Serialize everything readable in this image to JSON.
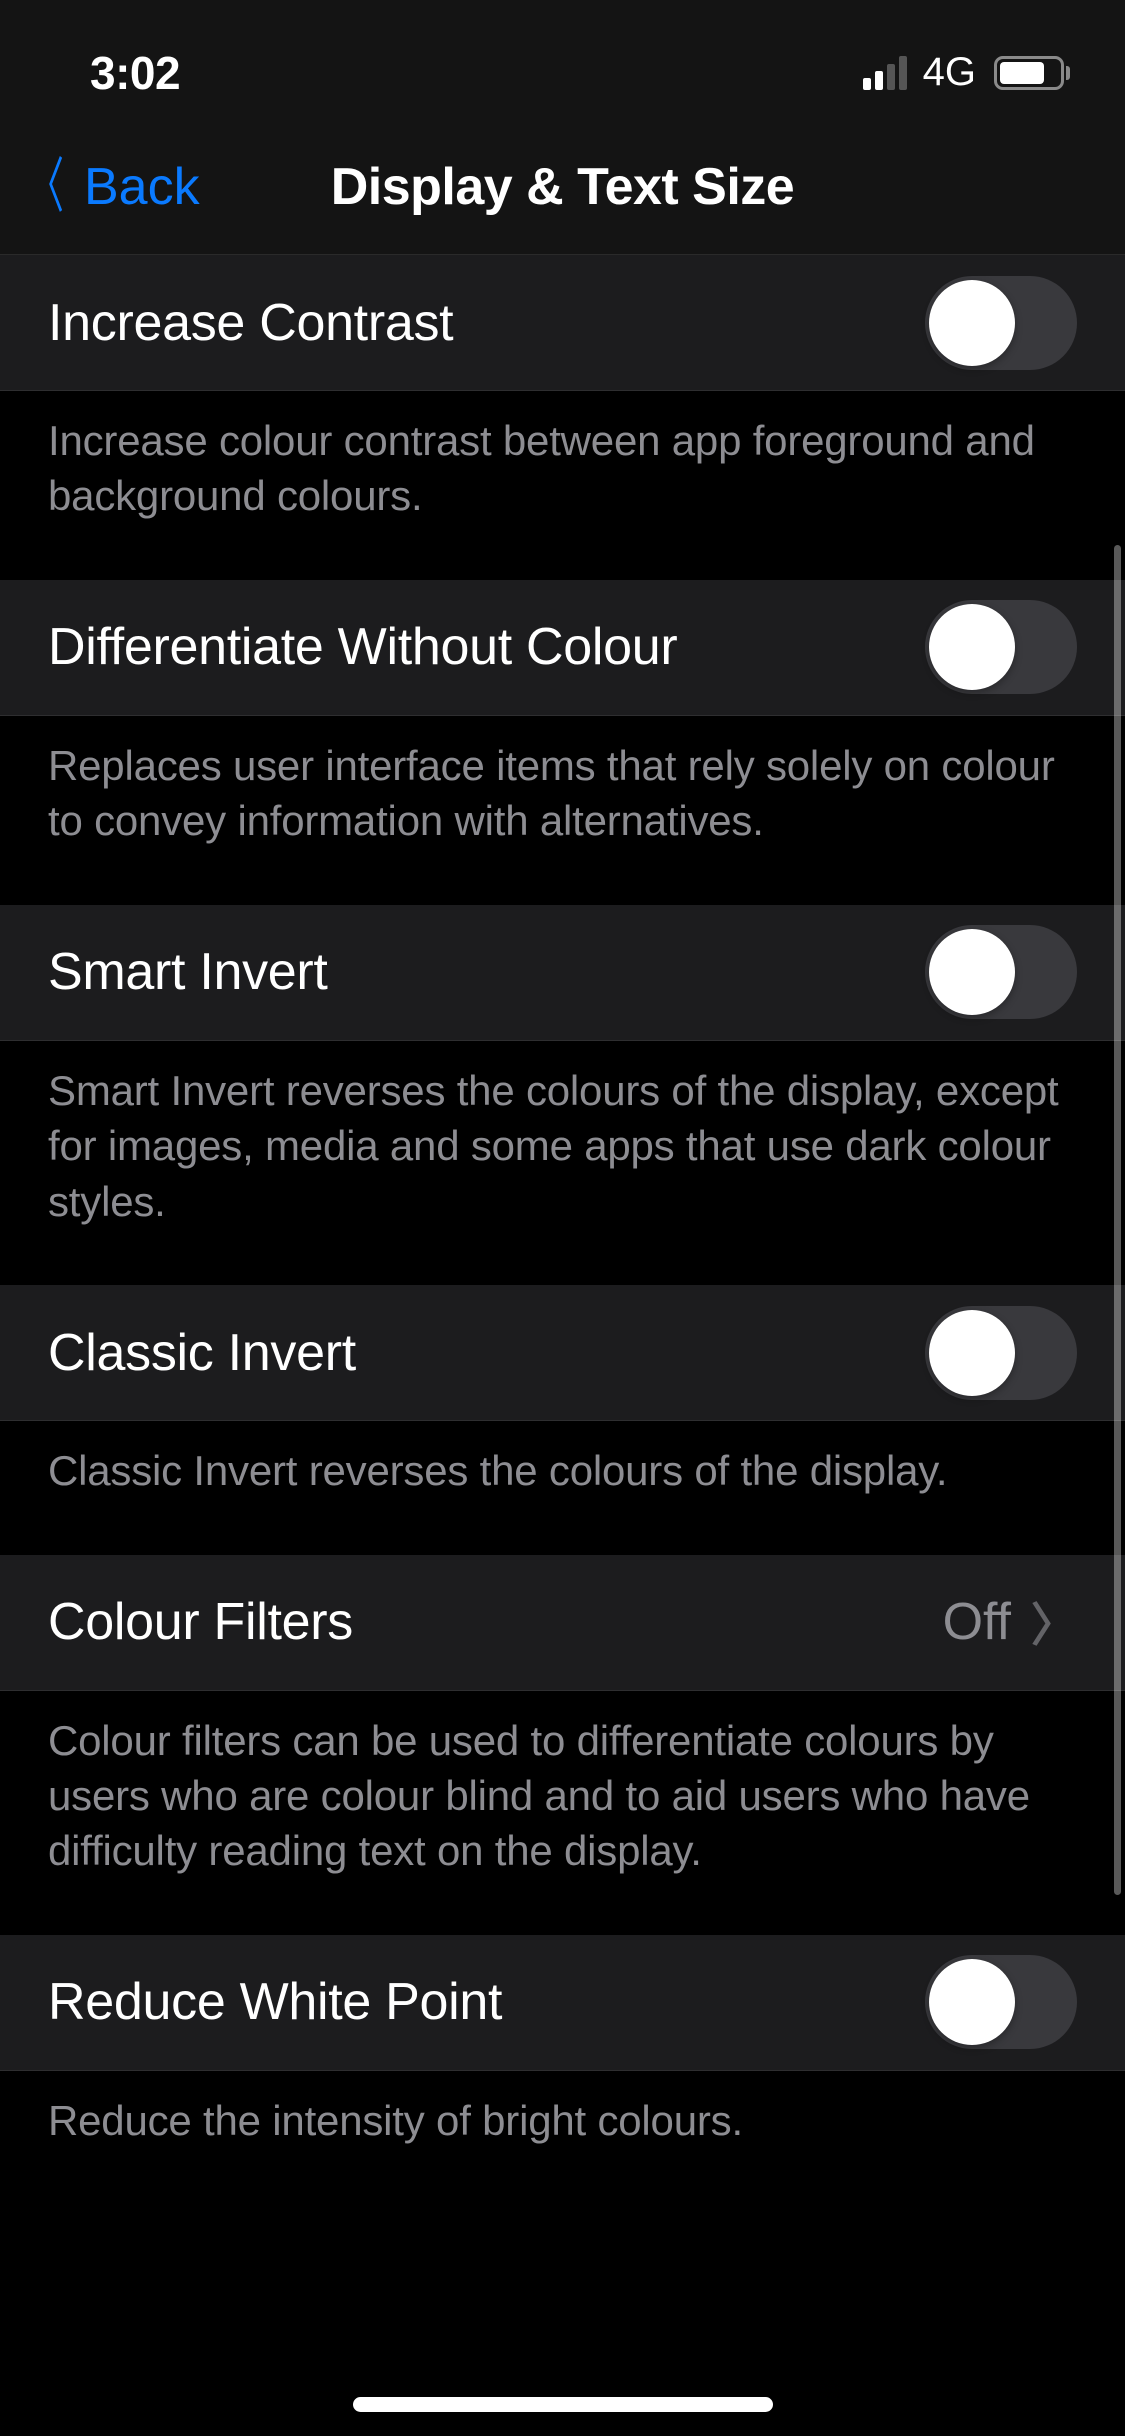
{
  "statusBar": {
    "time": "3:02",
    "networkType": "4G"
  },
  "nav": {
    "backLabel": "Back",
    "title": "Display & Text Size"
  },
  "sections": {
    "increaseContrast": {
      "label": "Increase Contrast",
      "footer": "Increase colour contrast between app foreground and background colours.",
      "value": false
    },
    "differentiateWithoutColour": {
      "label": "Differentiate Without Colour",
      "footer": "Replaces user interface items that rely solely on colour to convey information with alternatives.",
      "value": false
    },
    "smartInvert": {
      "label": "Smart Invert",
      "footer": "Smart Invert reverses the colours of the display, except for images, media and some apps that use dark colour styles.",
      "value": false
    },
    "classicInvert": {
      "label": "Classic Invert",
      "footer": "Classic Invert reverses the colours of the display.",
      "value": false
    },
    "colourFilters": {
      "label": "Colour Filters",
      "value": "Off",
      "footer": "Colour filters can be used to differentiate colours by users who are colour blind and to aid users who have difficulty reading text on the display."
    },
    "reduceWhitePoint": {
      "label": "Reduce White Point",
      "footer": "Reduce the intensity of bright colours.",
      "value": false
    }
  }
}
